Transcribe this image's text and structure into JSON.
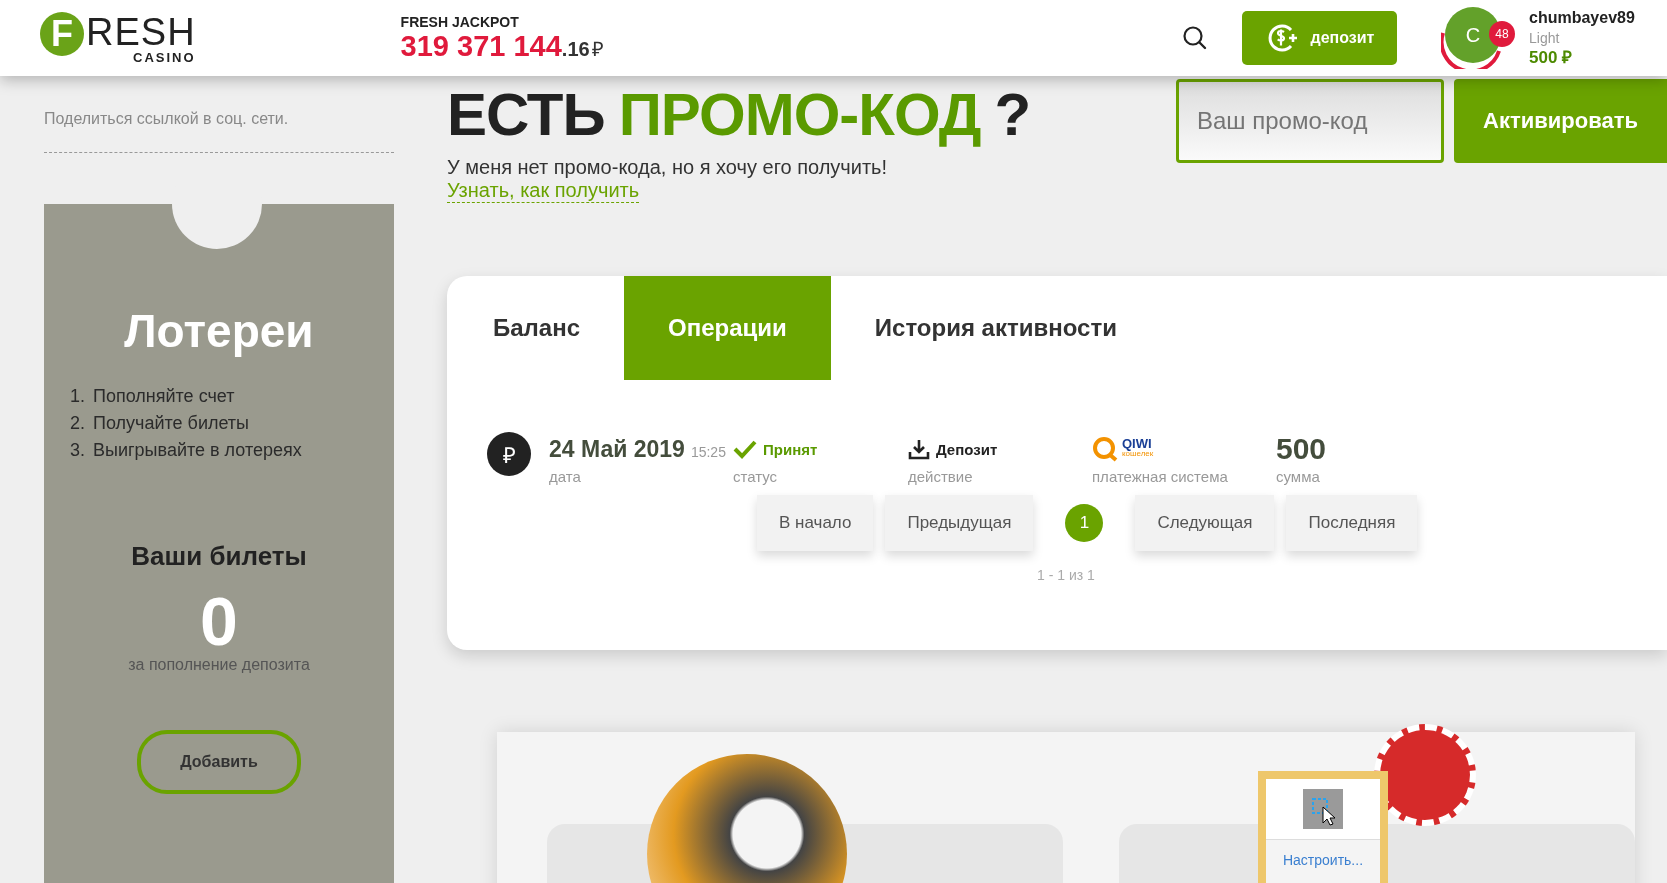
{
  "header": {
    "logo": {
      "initial": "F",
      "word": "RESH",
      "sub": "CASINO"
    },
    "jackpot": {
      "label": "FRESH JACKPOT",
      "amount": "319 371 144",
      "cents": ".16",
      "currency": "₽"
    },
    "deposit_button": "депозит",
    "user": {
      "avatar_letter": "С",
      "notifications": "48",
      "name": "chumbayev89",
      "status": "Light",
      "balance": "500 ₽"
    }
  },
  "sidebar": {
    "share": "Поделиться ссылкой в соц. сети.",
    "lottery": {
      "title": "Лотереи",
      "steps": [
        {
          "num": "1.",
          "text": "Пополняйте счет"
        },
        {
          "num": "2.",
          "text": "Получайте билеты"
        },
        {
          "num": "3.",
          "text": "Выигрывайте в лотереях"
        }
      ],
      "tickets_title": "Ваши билеты",
      "tickets_count": "0",
      "tickets_note": "за пополнение депозита",
      "add_button": "Добавить"
    }
  },
  "promo": {
    "heading": [
      {
        "text": "ЕСТЬ",
        "accent": false
      },
      {
        "text": "ПРОМО-КОД",
        "accent": true
      },
      {
        "text": "?",
        "accent": false
      }
    ],
    "subtitle": "У меня нет промо-кода, но я хочу его получить!",
    "link": "Узнать, как получить",
    "input": {
      "placeholder": "Ваш промо-код"
    },
    "activate_button": "Активировать"
  },
  "account": {
    "tabs": [
      {
        "label": "Баланс",
        "selected": false
      },
      {
        "label": "Операции",
        "selected": true
      },
      {
        "label": "История активности",
        "selected": false
      }
    ],
    "operations": [
      {
        "currency_symbol": "₽",
        "date": "24 Май 2019",
        "time": "15:25",
        "date_label": "дата",
        "status": "Принят",
        "status_ok": true,
        "status_label": "статус",
        "action": "Депозит",
        "action_label": "действие",
        "payment_logo": "QIWI",
        "payment_logo_sub": "кошелек",
        "payment_label": "платежная система",
        "amount": "500",
        "amount_label": "сумма"
      }
    ],
    "pagination": {
      "buttons": [
        {
          "label": "В начало",
          "kind": "nav"
        },
        {
          "label": "Предыдущая",
          "kind": "nav"
        },
        {
          "label": "1",
          "kind": "page",
          "selected": true
        },
        {
          "label": "Следующая",
          "kind": "nav"
        },
        {
          "label": "Последняя",
          "kind": "nav"
        }
      ],
      "summary": "1 - 1 из 1"
    }
  },
  "popup": {
    "link": "Настроить..."
  }
}
